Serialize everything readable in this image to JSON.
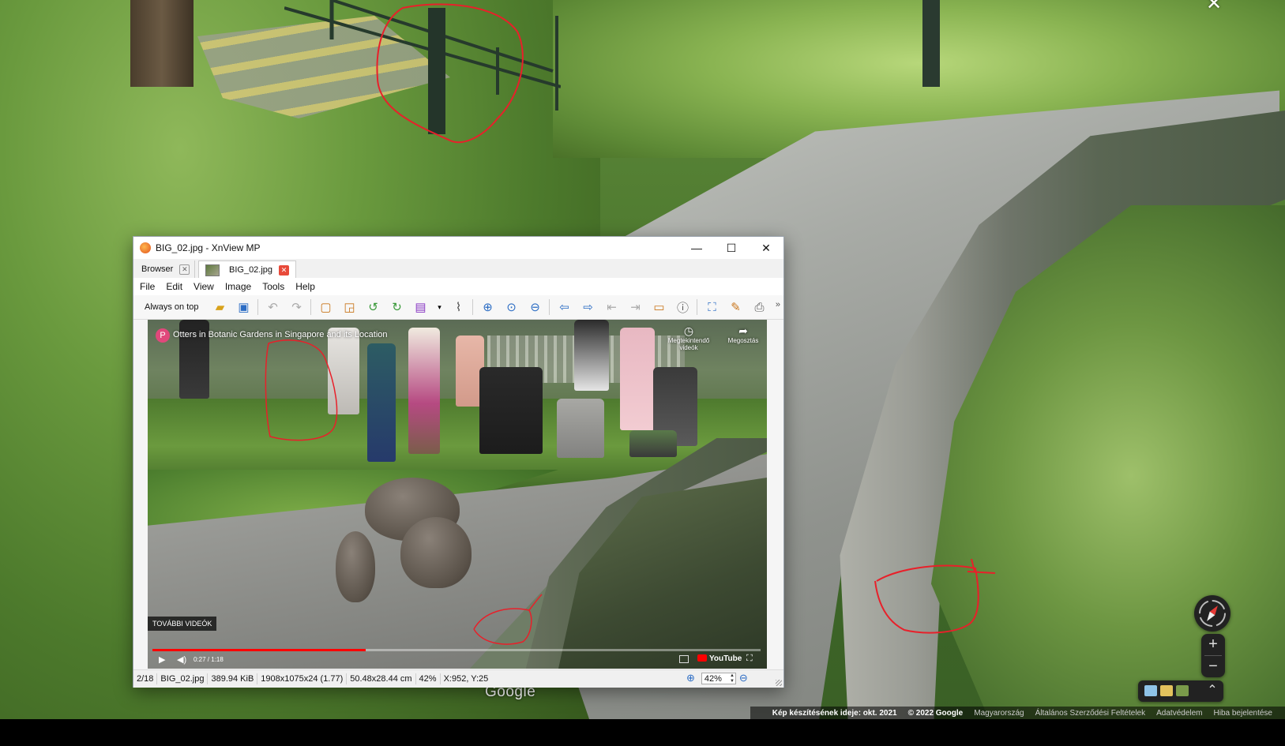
{
  "streetview": {
    "close_glyph": "✕",
    "google_logo": "Google",
    "footer": {
      "image_date": "Kép készítésének ideje: okt. 2021",
      "copyright": "© 2022 Google",
      "country": "Magyarország",
      "terms": "Általános Szerződési Feltételek",
      "privacy": "Adatvédelem",
      "report": "Hiba bejelentése"
    },
    "zoom_in": "+",
    "zoom_out": "−",
    "layers_caret": "⌃",
    "annotation_color": "#e8202a"
  },
  "window": {
    "title": "BIG_02.jpg - XnView MP",
    "min_glyph": "—",
    "max_glyph": "☐",
    "close_glyph": "✕",
    "tabs": [
      {
        "label": "Browser",
        "close": "✕"
      },
      {
        "label": "BIG_02.jpg",
        "close": "✕"
      }
    ],
    "menu": [
      "File",
      "Edit",
      "View",
      "Image",
      "Tools",
      "Help"
    ],
    "toolbar": {
      "always_on_top": "Always on top",
      "more": "»"
    }
  },
  "video": {
    "channel_initial": "P",
    "title": "Otters in Botanic Gardens in Singapore and its Location",
    "watch_later": "Megtekintendő videók",
    "share": "Megosztás",
    "more_videos": "TOVÁBBI VIDEÓK",
    "time": "0:27 / 1:18",
    "progress": 0.35,
    "youtube": "YouTube"
  },
  "status": {
    "index": "2/18",
    "filename": "BIG_02.jpg",
    "filesize": "389.94 KiB",
    "dimensions": "1908x1075x24 (1.77)",
    "print_size": "50.48x28.44 cm",
    "zoom": "42%",
    "cursor": "X:952, Y:25",
    "zoom_box": "42%"
  }
}
